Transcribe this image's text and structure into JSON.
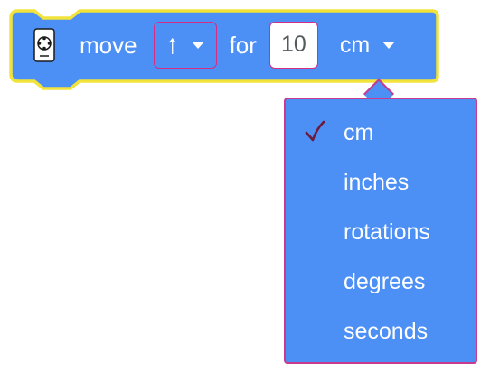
{
  "block": {
    "robot_icon": "robot-icon",
    "verb": "move",
    "direction_glyph": "↑",
    "preposition": "for",
    "amount_value": "10",
    "unit_value": "cm"
  },
  "unit_menu": {
    "selected": "cm",
    "options": [
      {
        "label": "cm",
        "checked": true
      },
      {
        "label": "inches",
        "checked": false
      },
      {
        "label": "rotations",
        "checked": false
      },
      {
        "label": "degrees",
        "checked": false
      },
      {
        "label": "seconds",
        "checked": false
      }
    ]
  },
  "colors": {
    "block_fill": "#4c8ff5",
    "block_outline": "#f2e33a",
    "field_outline": "#d62d87",
    "menu_border": "#c73a8e",
    "check_color": "#6b1a3a"
  }
}
